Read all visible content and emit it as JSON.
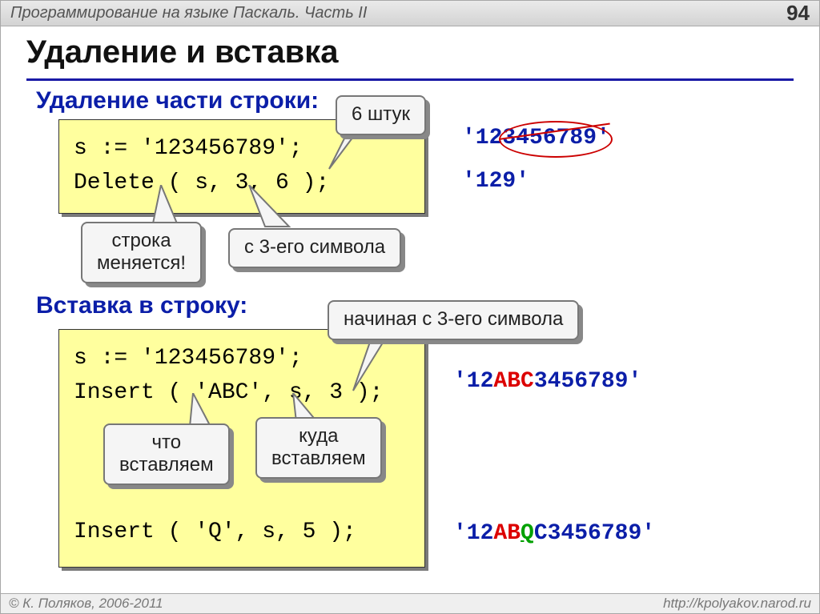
{
  "topbar": {
    "title": "Программирование на языке Паскаль. Часть II",
    "page": "94"
  },
  "title": "Удаление и вставка",
  "sub1": "Удаление части строки:",
  "sub2": "Вставка в строку:",
  "code1_line1": "s := '123456789';",
  "code1_line2": "Delete ( s, 3, 6 );",
  "code2_line1": "s := '123456789';",
  "code2_line2": "Insert ( 'ABC', s, 3 );",
  "code2_line3": "Insert ( 'Q', s, 5 );",
  "callouts": {
    "six": "6 штук",
    "changes_l1": "строка",
    "changes_l2": "меняется!",
    "from3": "с 3-его символа",
    "start3": "начиная с 3-его символа",
    "what_l1": "что",
    "what_l2": "вставляем",
    "where_l1": "куда",
    "where_l2": "вставляем"
  },
  "results": {
    "r1a": "'12",
    "r1b": "3456789",
    "r1c": "'",
    "r2": "'129'",
    "r3a": "'12",
    "r3b": "ABC",
    "r3c": "3456789'",
    "r4a": "'12",
    "r4b": "AB",
    "r4c": "Q",
    "r4d": "C3456789'"
  },
  "footer": {
    "left": "© К. Поляков, 2006-2011",
    "right": "http://kpolyakov.narod.ru"
  }
}
